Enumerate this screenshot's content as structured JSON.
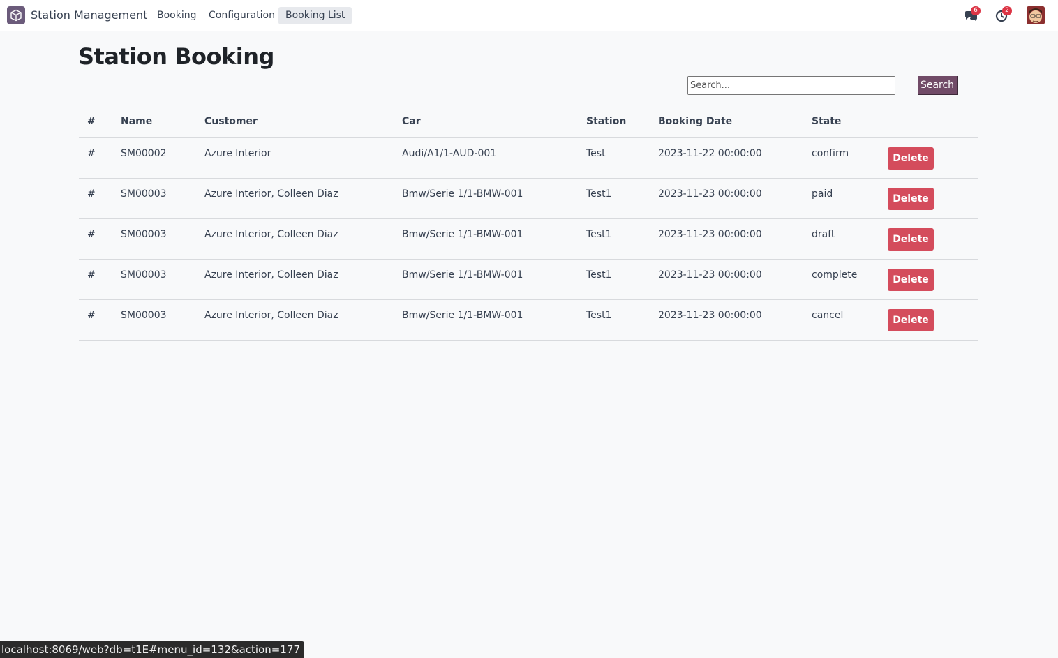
{
  "navbar": {
    "app_name": "Station Management",
    "menu": {
      "booking": "Booking",
      "configuration": "Configuration",
      "booking_list": "Booking List"
    },
    "messages_count": "6",
    "activities_count": "2"
  },
  "page": {
    "title": "Station Booking"
  },
  "search": {
    "placeholder": "Search...",
    "button_label": "Search"
  },
  "table": {
    "headers": {
      "index": "#",
      "name": "Name",
      "customer": "Customer",
      "car": "Car",
      "station": "Station",
      "booking_date": "Booking Date",
      "state": "State"
    },
    "rows": [
      {
        "index": "#",
        "name": "SM00002",
        "customer": "Azure Interior",
        "car": "Audi/A1/1-AUD-001",
        "station": "Test",
        "booking_date": "2023-11-22 00:00:00",
        "state": "confirm",
        "action": "Delete"
      },
      {
        "index": "#",
        "name": "SM00003",
        "customer": "Azure Interior, Colleen Diaz",
        "car": "Bmw/Serie 1/1-BMW-001",
        "station": "Test1",
        "booking_date": "2023-11-23 00:00:00",
        "state": "paid",
        "action": "Delete"
      },
      {
        "index": "#",
        "name": "SM00003",
        "customer": "Azure Interior, Colleen Diaz",
        "car": "Bmw/Serie 1/1-BMW-001",
        "station": "Test1",
        "booking_date": "2023-11-23 00:00:00",
        "state": "draft",
        "action": "Delete"
      },
      {
        "index": "#",
        "name": "SM00003",
        "customer": "Azure Interior, Colleen Diaz",
        "car": "Bmw/Serie 1/1-BMW-001",
        "station": "Test1",
        "booking_date": "2023-11-23 00:00:00",
        "state": "complete",
        "action": "Delete"
      },
      {
        "index": "#",
        "name": "SM00003",
        "customer": "Azure Interior, Colleen Diaz",
        "car": "Bmw/Serie 1/1-BMW-001",
        "station": "Test1",
        "booking_date": "2023-11-23 00:00:00",
        "state": "cancel",
        "action": "Delete"
      }
    ]
  },
  "status_bar": {
    "url": "localhost:8069/web?db=t1E#menu_id=132&action=177"
  },
  "colors": {
    "brand": "#714b67",
    "danger": "#d44c5c"
  },
  "icons": {
    "app_logo": "app-cube-icon",
    "messages": "chat-bubbles-icon",
    "activities": "clock-icon"
  }
}
